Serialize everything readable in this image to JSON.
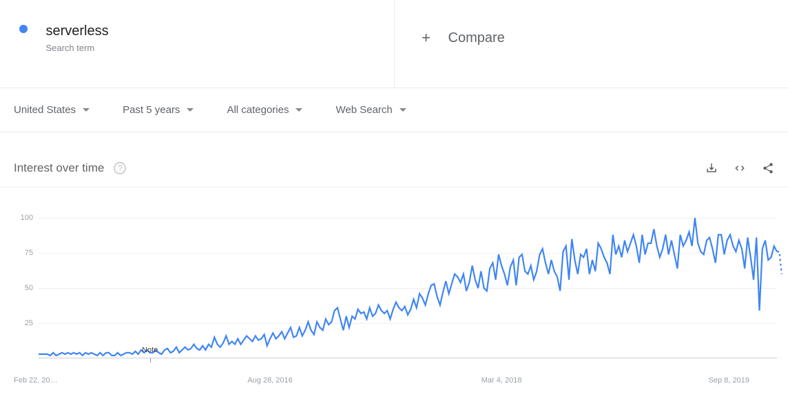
{
  "header": {
    "term": "serverless",
    "sub": "Search term",
    "compare": "Compare"
  },
  "filters": {
    "region": "United States",
    "time": "Past 5 years",
    "category": "All categories",
    "search_type": "Web Search"
  },
  "section": {
    "title": "Interest over time"
  },
  "chart_data": {
    "type": "line",
    "title": "Interest over time",
    "ylabel": "",
    "xlabel": "",
    "ylim": [
      0,
      105
    ],
    "y_ticks": [
      25,
      50,
      75,
      100
    ],
    "x_tick_labels": [
      "Feb 22, 20…",
      "Aug 28, 2016",
      "Mar 4, 2018",
      "Sep 8, 2019"
    ],
    "x_tick_positions": [
      0,
      79,
      158,
      237
    ],
    "note_index": 38,
    "note_label": "Note",
    "series": [
      {
        "name": "serverless",
        "color": "#3f85f4",
        "values": [
          3,
          3,
          3,
          3,
          2,
          4,
          2,
          3,
          4,
          3,
          4,
          3,
          4,
          3,
          4,
          2,
          4,
          3,
          4,
          3,
          2,
          4,
          2,
          4,
          4,
          2,
          2,
          4,
          2,
          3,
          4,
          4,
          3,
          5,
          3,
          6,
          4,
          6,
          4,
          4,
          6,
          4,
          3,
          6,
          7,
          4,
          5,
          8,
          4,
          6,
          8,
          6,
          7,
          10,
          7,
          6,
          9,
          6,
          10,
          8,
          15,
          10,
          8,
          11,
          16,
          10,
          12,
          10,
          14,
          10,
          13,
          16,
          14,
          12,
          16,
          13,
          14,
          17,
          9,
          14,
          18,
          14,
          16,
          19,
          14,
          18,
          22,
          15,
          16,
          22,
          16,
          20,
          26,
          20,
          17,
          26,
          22,
          20,
          28,
          24,
          26,
          34,
          36,
          28,
          20,
          30,
          22,
          30,
          28,
          35,
          32,
          33,
          28,
          36,
          30,
          32,
          38,
          34,
          32,
          34,
          28,
          35,
          40,
          36,
          34,
          37,
          31,
          35,
          42,
          36,
          46,
          43,
          38,
          46,
          52,
          53,
          44,
          38,
          47,
          55,
          46,
          53,
          60,
          58,
          54,
          60,
          48,
          54,
          66,
          56,
          50,
          62,
          50,
          48,
          64,
          68,
          56,
          74,
          66,
          60,
          52,
          65,
          70,
          52,
          72,
          74,
          62,
          60,
          66,
          56,
          62,
          74,
          78,
          68,
          60,
          70,
          62,
          58,
          48,
          76,
          80,
          56,
          85,
          70,
          60,
          74,
          72,
          78,
          60,
          70,
          62,
          82,
          78,
          72,
          68,
          60,
          88,
          74,
          80,
          72,
          84,
          76,
          82,
          88,
          80,
          68,
          88,
          74,
          82,
          82,
          92,
          80,
          72,
          78,
          88,
          74,
          84,
          74,
          64,
          88,
          80,
          84,
          90,
          80,
          100,
          82,
          76,
          74,
          84,
          86,
          78,
          68,
          88,
          88,
          74,
          84,
          88,
          80,
          76,
          84,
          78,
          64,
          86,
          72,
          56,
          86,
          34,
          78,
          84,
          70,
          72,
          80,
          76
        ]
      }
    ],
    "trailing_dash": [
      76,
      60
    ]
  }
}
